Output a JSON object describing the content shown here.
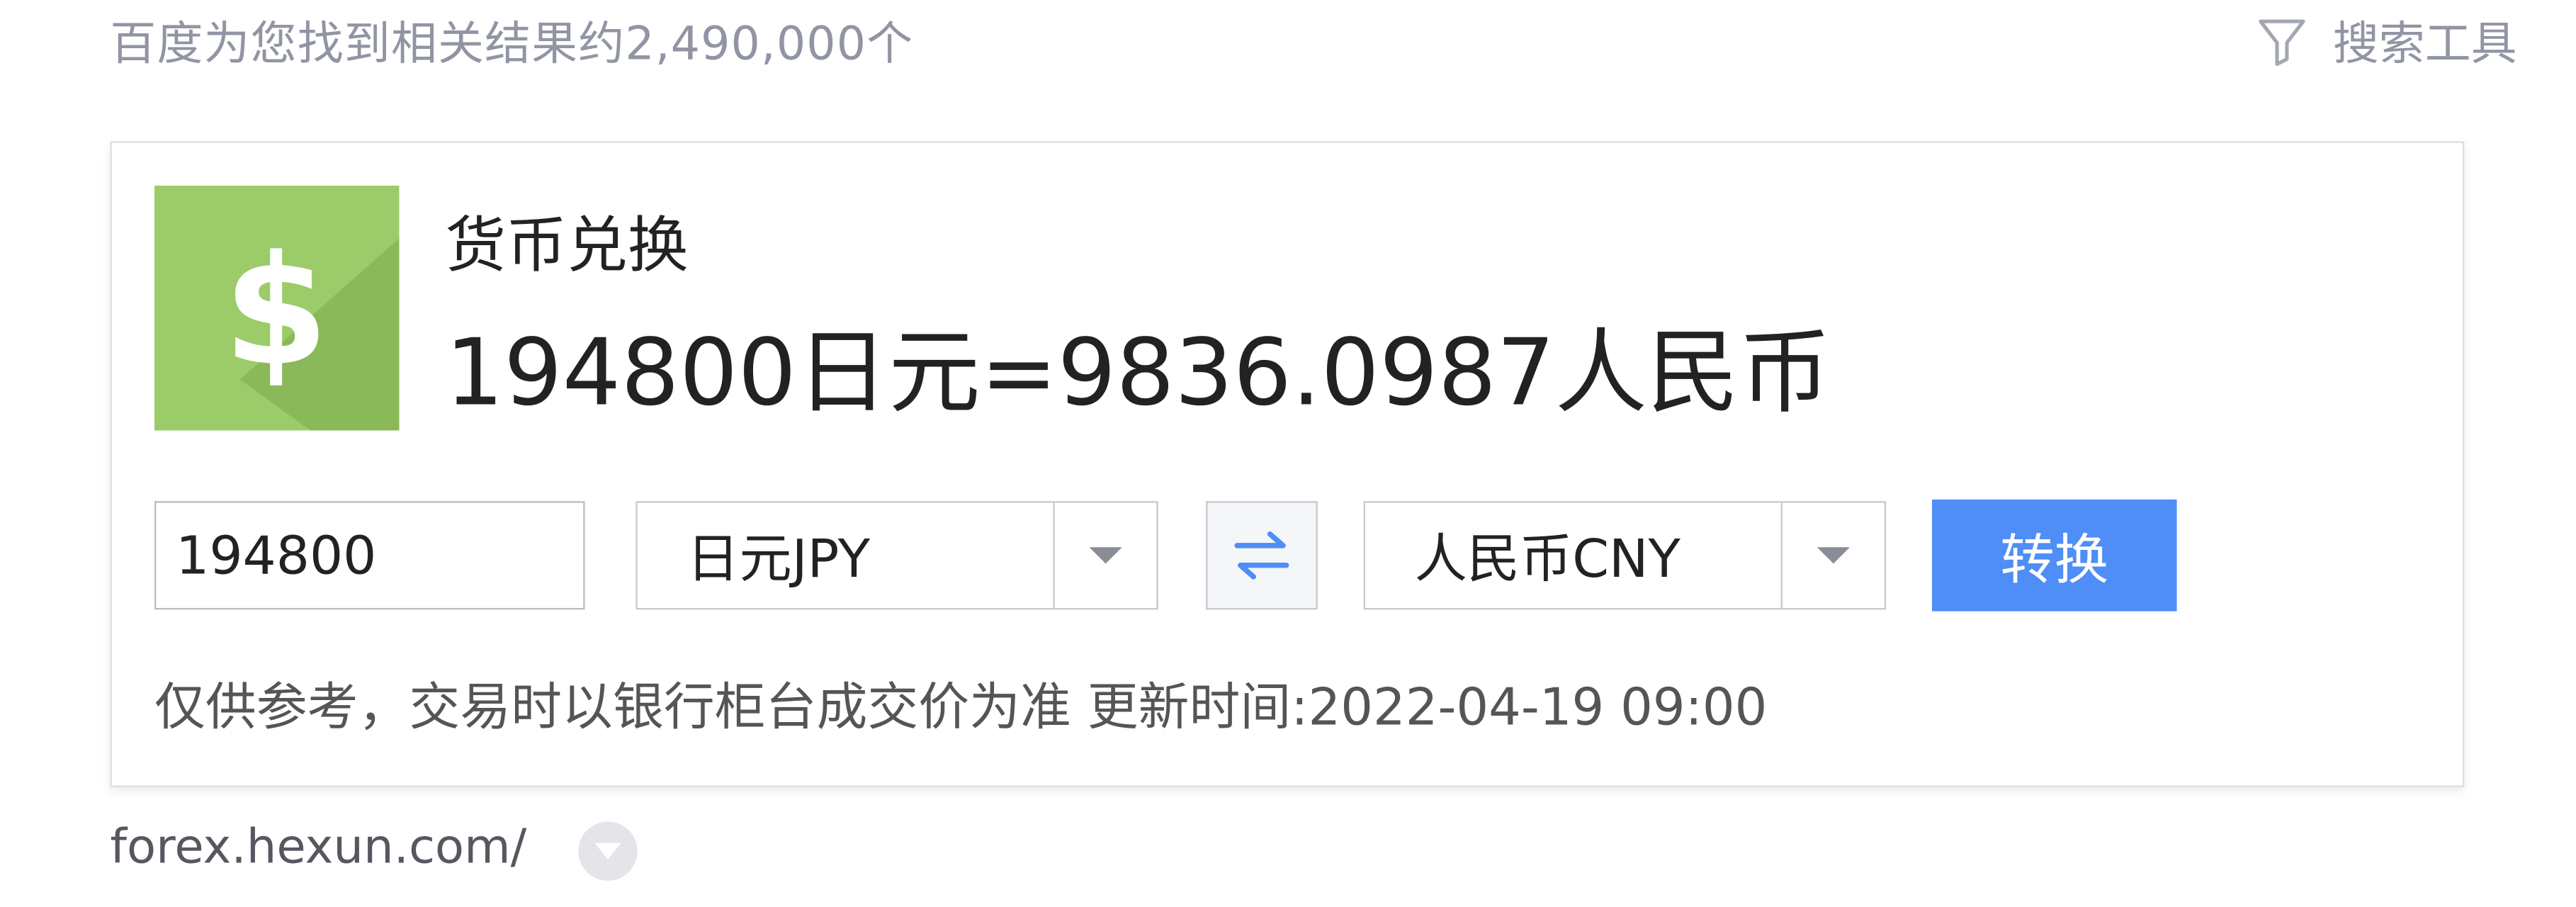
{
  "header": {
    "results_count": "百度为您找到相关结果约2,490,000个",
    "search_tools_label": "搜索工具",
    "search_tools_icon": "filter-icon"
  },
  "card": {
    "logo_icon": "dollar-icon",
    "logo_glyph": "$",
    "title": "货币兑换",
    "result": "194800日元=9836.0987人民币",
    "amount_value": "194800",
    "from_currency": "日元JPY",
    "to_currency": "人民币CNY",
    "swap_icon": "swap-arrows-icon",
    "convert_label": "转换",
    "note": "仅供参考，交易时以银行柜台成交价为准 更新时间:2022-04-19 09:00"
  },
  "footer": {
    "url": "forex.hexun.com/",
    "menu_icon": "chevron-down-icon"
  },
  "colors": {
    "accent": "#4e8ef6",
    "logo_green": "#9ccc6a",
    "muted_text": "#9195a3"
  }
}
